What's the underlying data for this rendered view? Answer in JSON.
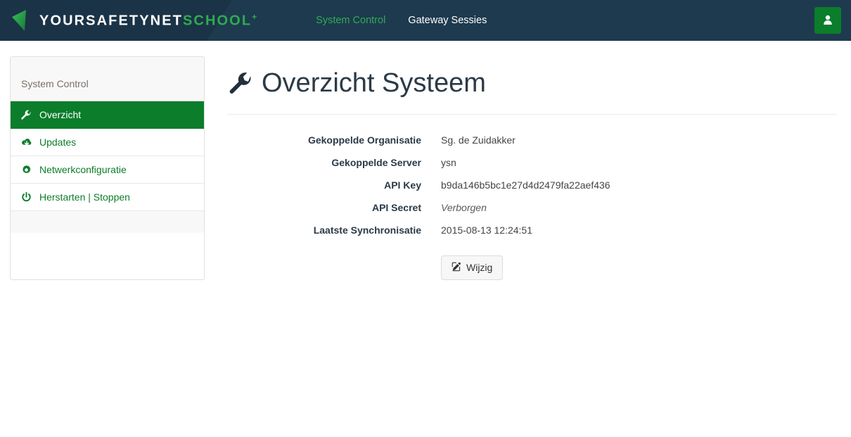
{
  "navbar": {
    "brand": {
      "icon": "triangle-left-logo-mark",
      "name_primary": "YOURSAFETYNET",
      "name_secondary": "SCHOOL",
      "name_suffix": "+"
    },
    "links": [
      {
        "label": "System Control",
        "active": true
      },
      {
        "label": "Gateway Sessies",
        "active": false
      }
    ],
    "user_button": {
      "icon": "user-icon",
      "label": ""
    },
    "colors": {
      "background": "#1e3a4f",
      "brand_zone": "#1b3347",
      "accent_green": "#2eab52",
      "button_green": "#0b7d2b"
    }
  },
  "sidebar": {
    "heading": "System Control",
    "items": [
      {
        "label": "Overzicht",
        "icon": "wrench-icon",
        "active": true
      },
      {
        "label": "Updates",
        "icon": "cloud-download-icon",
        "active": false
      },
      {
        "label": "Netwerkconfiguratie",
        "icon": "gear-icon",
        "active": false
      },
      {
        "label": "Herstarten | Stoppen",
        "icon": "power-icon",
        "active": false
      }
    ]
  },
  "main": {
    "title": "Overzicht Systeem",
    "title_icon": "wrench-icon",
    "details": [
      {
        "term": "Gekoppelde Organisatie",
        "value": "Sg. de Zuidakker",
        "muted": false
      },
      {
        "term": "Gekoppelde Server",
        "value": "ysn",
        "muted": false
      },
      {
        "term": "API Key",
        "value": "b9da146b5bc1e27d4d2479fa22aef436",
        "muted": false
      },
      {
        "term": "API Secret",
        "value": "Verborgen",
        "muted": true
      },
      {
        "term": "Laatste Synchronisatie",
        "value": "2015-08-13 12:24:51",
        "muted": false
      }
    ],
    "edit_button": {
      "label": "Wijzig",
      "icon": "pencil-square-icon"
    }
  }
}
